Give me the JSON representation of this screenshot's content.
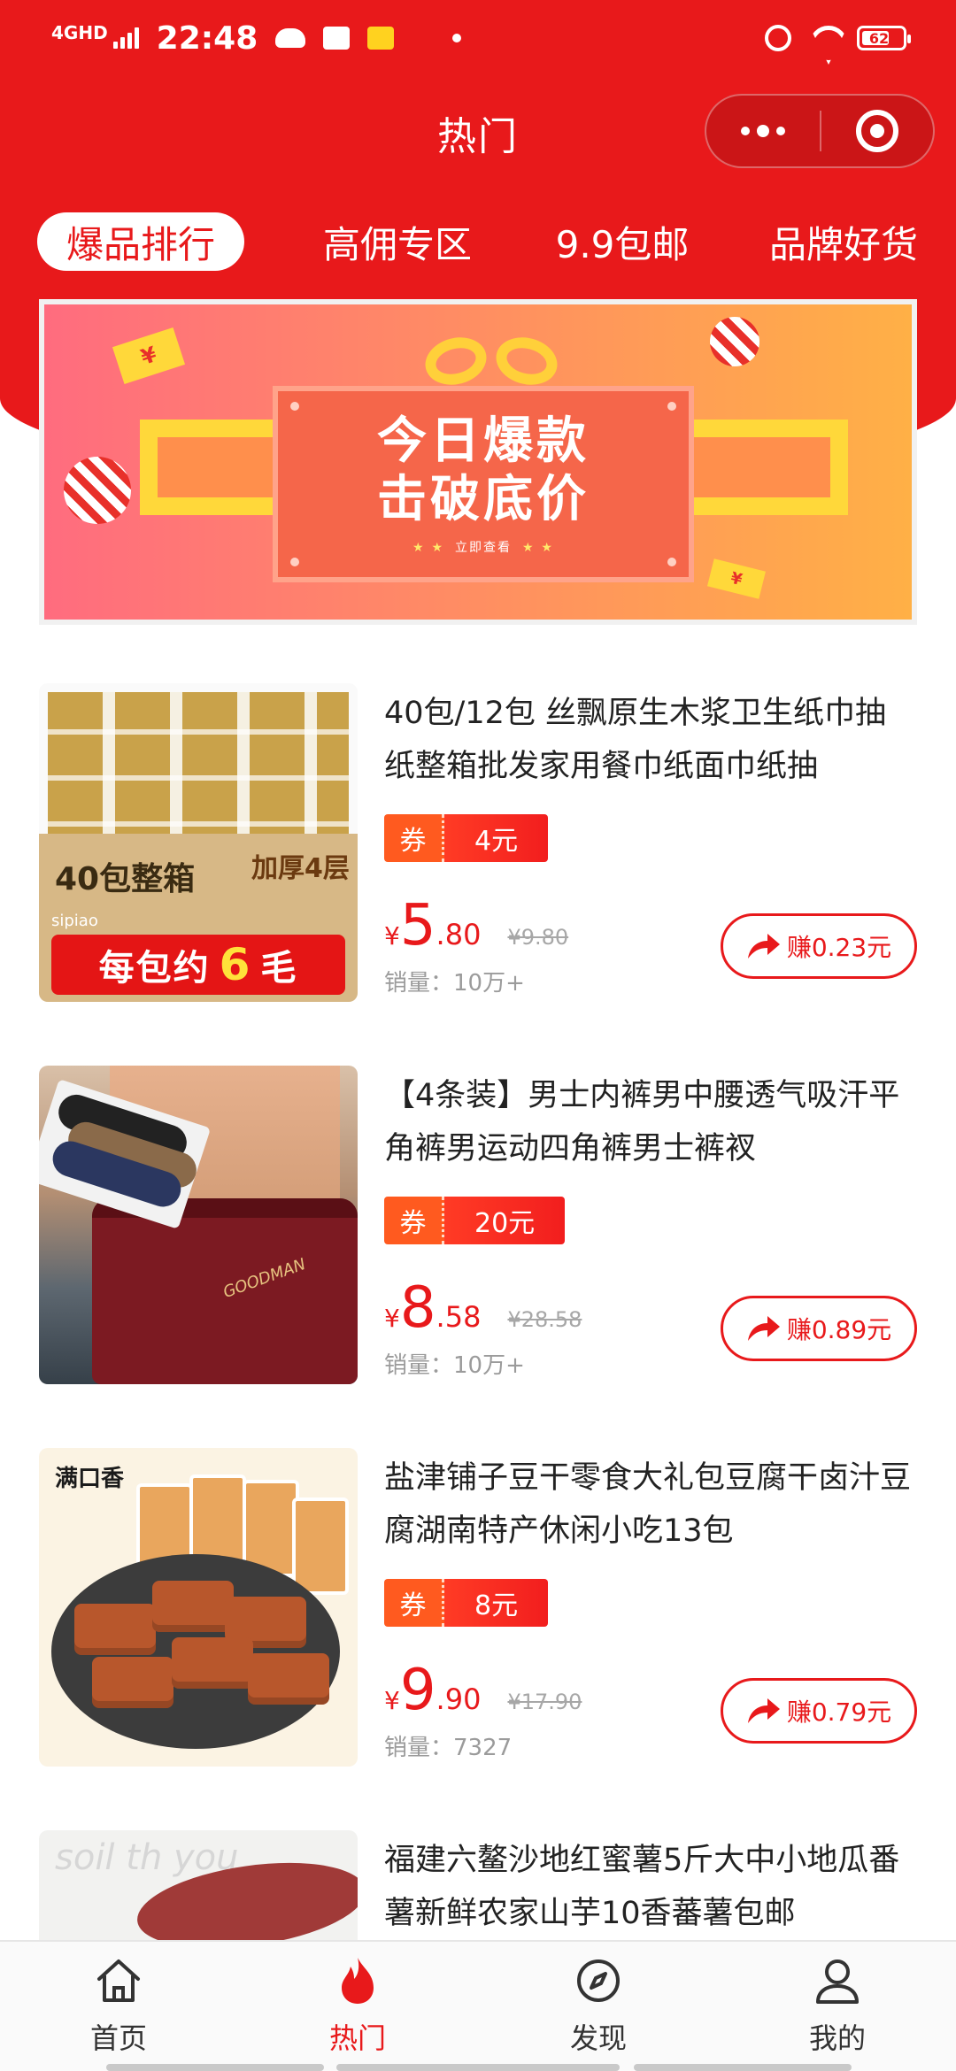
{
  "status_bar": {
    "network": "4GHD",
    "time": "22:48",
    "battery": "62"
  },
  "header": {
    "title": "热门"
  },
  "tabs": [
    {
      "label": "爆品排行",
      "active": true
    },
    {
      "label": "高佣专区",
      "active": false
    },
    {
      "label": "9.9包邮",
      "active": false
    },
    {
      "label": "品牌好货",
      "active": false
    }
  ],
  "banner": {
    "line1": "今日爆款",
    "line2": "击破底价",
    "cta": "立即查看",
    "coin_symbol": "¥"
  },
  "products": [
    {
      "title": "40包/12包 丝飘原生木浆卫生纸巾抽纸整箱批发家用餐巾纸面巾纸抽",
      "coupon_label": "券",
      "coupon_value": "4元",
      "price_symbol": "¥",
      "price_int": "5",
      "price_dec": ".80",
      "original_price": "¥9.80",
      "sales": "销量：10万+",
      "earn": "赚0.23元",
      "image_text": {
        "carton_left": "40包整箱",
        "carton_right": "加厚4层",
        "brand": "sipiao",
        "promo_pre": "每包约",
        "promo_num": "6",
        "promo_post": "毛"
      }
    },
    {
      "title": "【4条装】男士内裤男中腰透气吸汗平角裤男运动四角裤男士裤衩",
      "coupon_label": "券",
      "coupon_value": "20元",
      "price_symbol": "¥",
      "price_int": "8",
      "price_dec": ".58",
      "original_price": "¥28.58",
      "sales": "销量：10万+",
      "earn": "赚0.89元",
      "image_text": {
        "brand": "GOODMAN"
      }
    },
    {
      "title": "盐津铺子豆干零食大礼包豆腐干卤汁豆腐湖南特产休闲小吃13包",
      "coupon_label": "券",
      "coupon_value": "8元",
      "price_symbol": "¥",
      "price_int": "9",
      "price_dec": ".90",
      "original_price": "¥17.90",
      "sales": "销量：7327",
      "earn": "赚0.79元",
      "image_text": {
        "logo": "满口香"
      }
    },
    {
      "title": "福建六鳌沙地红蜜薯5斤大中小地瓜番薯新鲜农家山芋10香蕃薯包邮",
      "image_text": {
        "script": "soil th you"
      }
    }
  ],
  "tabbar": [
    {
      "label": "首页",
      "icon": "home-icon",
      "active": false
    },
    {
      "label": "热门",
      "icon": "flame-icon",
      "active": true
    },
    {
      "label": "发现",
      "icon": "compass-icon",
      "active": false
    },
    {
      "label": "我的",
      "icon": "user-icon",
      "active": false
    }
  ],
  "colors": {
    "brand_red": "#e8191b",
    "coupon_orange": "#ff5a1f",
    "muted_gray": "#9b9b9b"
  }
}
